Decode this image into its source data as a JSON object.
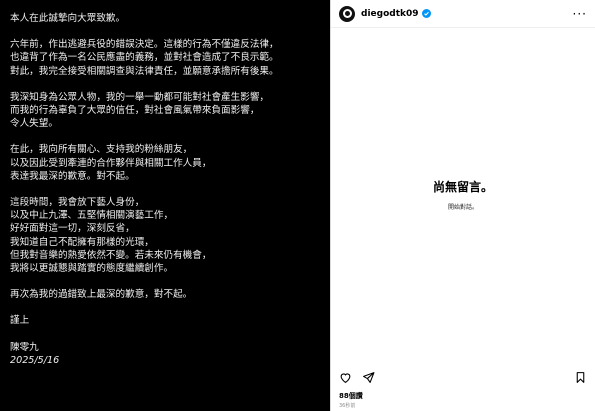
{
  "post": {
    "lines": [
      "本人在此誠摯向大眾致歉。",
      "",
      "六年前，作出逃避兵役的錯誤決定。這樣的行為不僅違反法律，",
      "也違背了作為一名公民應盡的義務，並對社會造成了不良示範。",
      "對此，我完全接受相關調查與法律責任，並願意承擔所有後果。",
      "",
      "我深知身為公眾人物，我的一舉一動都可能對社會產生影響，",
      "而我的行為辜負了大眾的信任，對社會風氣帶來負面影響，",
      "令人失望。",
      "",
      "在此，我向所有關心、支持我的粉絲朋友，",
      "以及因此受到牽連的合作夥伴與相關工作人員，",
      "表達我最深的歉意。對不起。",
      "",
      "這段時間，我會放下藝人身份，",
      "以及中止九澤、五堅情相關演藝工作，",
      "好好面對這一切，深刻反省，",
      "我知道自己不配擁有那樣的光環，",
      "但我對音樂的熱愛依然不變。若未來仍有機會，",
      "我將以更誠懇與踏實的態度繼續創作。",
      "",
      "再次為我的過錯致上最深的歉意，對不起。",
      "",
      "謹上",
      "",
      "陳零九"
    ],
    "date": "2025/5/16"
  },
  "side": {
    "username": "diegodtk09",
    "empty_title": "尚無留言。",
    "empty_sub": "開始對話。",
    "likes": "88個讚",
    "post_date": "36秒前"
  },
  "icons": {
    "avatar": "avatar-icon",
    "verified": "verified-badge-icon",
    "more": "more-options-icon",
    "like": "heart-icon",
    "share": "send-icon",
    "save": "bookmark-icon"
  },
  "colors": {
    "verified": "#0095f6",
    "background": "#000000"
  }
}
